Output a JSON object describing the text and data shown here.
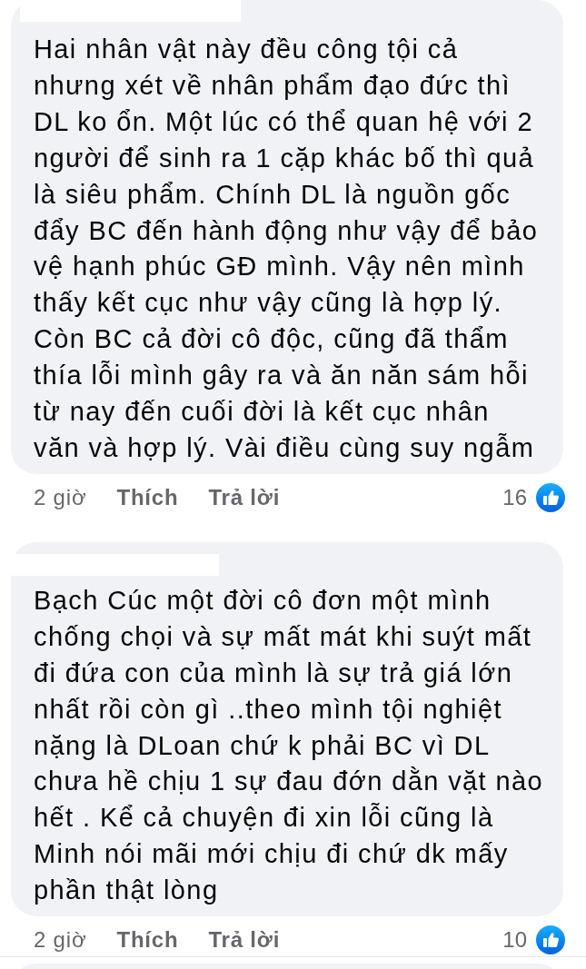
{
  "comments": [
    {
      "text_lines": [
        "Hai nhân vật này đều công tội cả",
        "nhưng xét về nhân phẩm đạo đức thì",
        "DL ko ổn. Một lúc có thể quan hệ với 2",
        "người để sinh ra 1 cặp khác bố thì quả",
        "là siêu phẩm. Chính DL là nguồn gốc",
        "đẩy BC đến hành động như vậy để bảo",
        "vệ hạnh phúc GĐ mình. Vậy nên mình",
        "thấy kết cục như vậy cũng là hợp lý.",
        "Còn BC cả đời cô độc, cũng đã thẩm",
        "thía lỗi mình gây ra và ăn năn sám hỗi",
        "từ nay đến cuối đời là kết cục nhân",
        "văn và hợp lý. Vài điều cùng suy ngẫm"
      ],
      "time": "2 giờ",
      "like_label": "Thích",
      "reply_label": "Trả lời",
      "reaction_count": "16"
    },
    {
      "text_lines": [
        "Bạch Cúc một đời cô đơn một mình",
        "chống chọi và sự mất mát khi suýt mất",
        "đi đứa con của mình là sự trả giá lớn",
        "nhất rồi còn gì ..theo mình tội nghiệt",
        "nặng là DLoan chứ k phải BC vì DL",
        "chưa hề chịu 1 sự đau đớn dằn vặt nào",
        "hết . Kể cả chuyện đi xin lỗi cũng là",
        "Minh nói mãi mới chịu đi chứ dk mấy",
        "phần thật lòng"
      ],
      "time": "2 giờ",
      "like_label": "Thích",
      "reply_label": "Trả lời",
      "reaction_count": "10"
    }
  ]
}
